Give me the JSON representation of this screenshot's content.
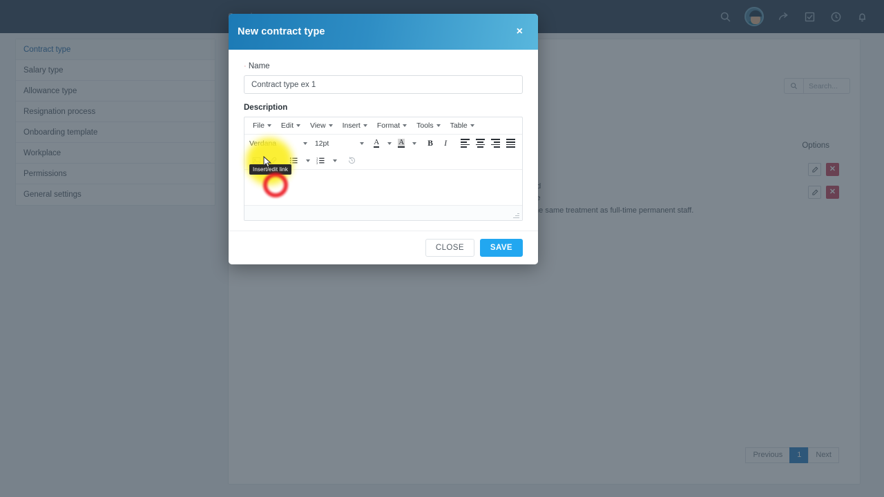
{
  "topnav": {
    "search_placeholder": "Search...",
    "icons": [
      "search-icon",
      "avatar",
      "share-icon",
      "tasks-icon",
      "clock-icon",
      "bell-icon"
    ]
  },
  "sidebar": {
    "items": [
      {
        "label": "Contract type",
        "active": true
      },
      {
        "label": "Salary type",
        "active": false
      },
      {
        "label": "Allowance type",
        "active": false
      },
      {
        "label": "Resignation process",
        "active": false
      },
      {
        "label": "Onboarding template",
        "active": false
      },
      {
        "label": "Workplace",
        "active": false
      },
      {
        "label": "Permissions",
        "active": false
      },
      {
        "label": "General settings",
        "active": false
      }
    ]
  },
  "content": {
    "search_placeholder": "Search...",
    "options_header": "Options",
    "row_fragments": [
      "ed",
      "ce",
      "the same treatment as full-time permanent staff."
    ],
    "pagination": {
      "previous": "Previous",
      "current": "1",
      "next": "Next"
    }
  },
  "modal": {
    "title": "New contract type",
    "close_icon": "×",
    "name_label": "Name",
    "name_required_mark": "·",
    "name_value": "Contract type ex 1",
    "name_placeholder": "",
    "description_label": "Description",
    "editor": {
      "menus": [
        "File",
        "Edit",
        "View",
        "Insert",
        "Format",
        "Tools",
        "Table"
      ],
      "font_family": "Verdana",
      "font_size": "12pt",
      "buttons": [
        "text-color-icon",
        "highlight-color-icon",
        "bold-icon",
        "italic-icon",
        "align-left-icon",
        "align-center-icon",
        "align-right-icon",
        "align-justify-icon",
        "insert-image-icon",
        "insert-link-icon",
        "bullet-list-icon",
        "numbered-list-icon",
        "restore-draft-icon"
      ],
      "bold_label": "B",
      "italic_label": "I",
      "content": ""
    },
    "close_button": "CLOSE",
    "save_button": "SAVE"
  },
  "annotation": {
    "tooltip": "Insert/edit link",
    "highlight_color": "#fbee20",
    "ring_color": "#ec1c24"
  }
}
